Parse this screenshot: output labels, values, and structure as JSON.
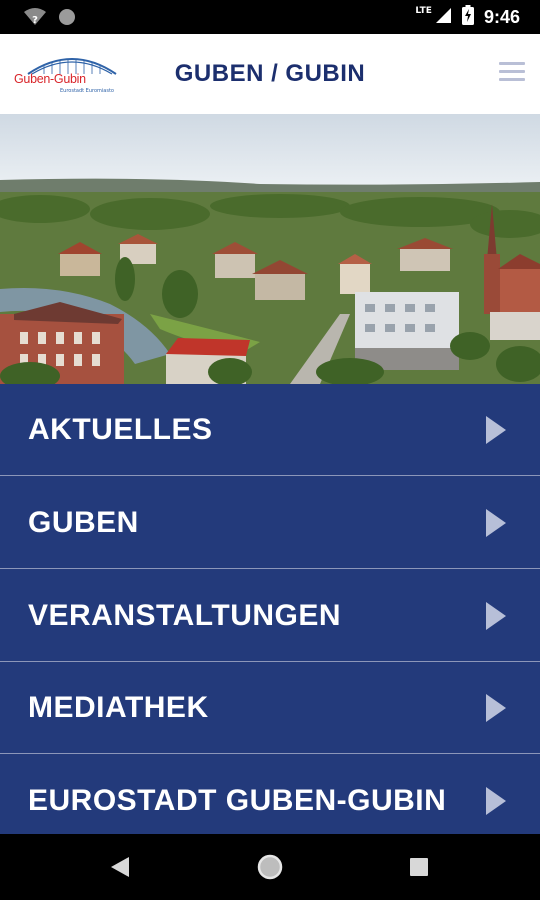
{
  "status_bar": {
    "network_label": "LTE",
    "time": "9:46",
    "icons": [
      "wifi-question-icon",
      "circle-notification-icon",
      "lte-signal-icon",
      "battery-charging-icon"
    ]
  },
  "header": {
    "logo_text": "Guben-Gubin",
    "logo_subtext": "Eurostadt Euromiasto",
    "title": "GUBEN / GUBIN",
    "menu_icon": "hamburger-menu-icon"
  },
  "hero": {
    "description_icon": "city-panorama-image"
  },
  "menu": {
    "items": [
      {
        "label": "AKTUELLES"
      },
      {
        "label": "GUBEN"
      },
      {
        "label": "VERANSTALTUNGEN"
      },
      {
        "label": "MEDIATHEK"
      },
      {
        "label": "EUROSTADT GUBEN-GUBIN"
      }
    ],
    "chevron_icon": "chevron-right-icon"
  },
  "nav_bar": {
    "icons": [
      "back-icon",
      "home-icon",
      "recents-icon"
    ]
  },
  "colors": {
    "brand_navy": "#233a7b",
    "title_navy": "#1c2f6e",
    "logo_red": "#d9262b",
    "logo_blue": "#2f63a8",
    "menu_icon_gray": "#b9bfd6"
  }
}
